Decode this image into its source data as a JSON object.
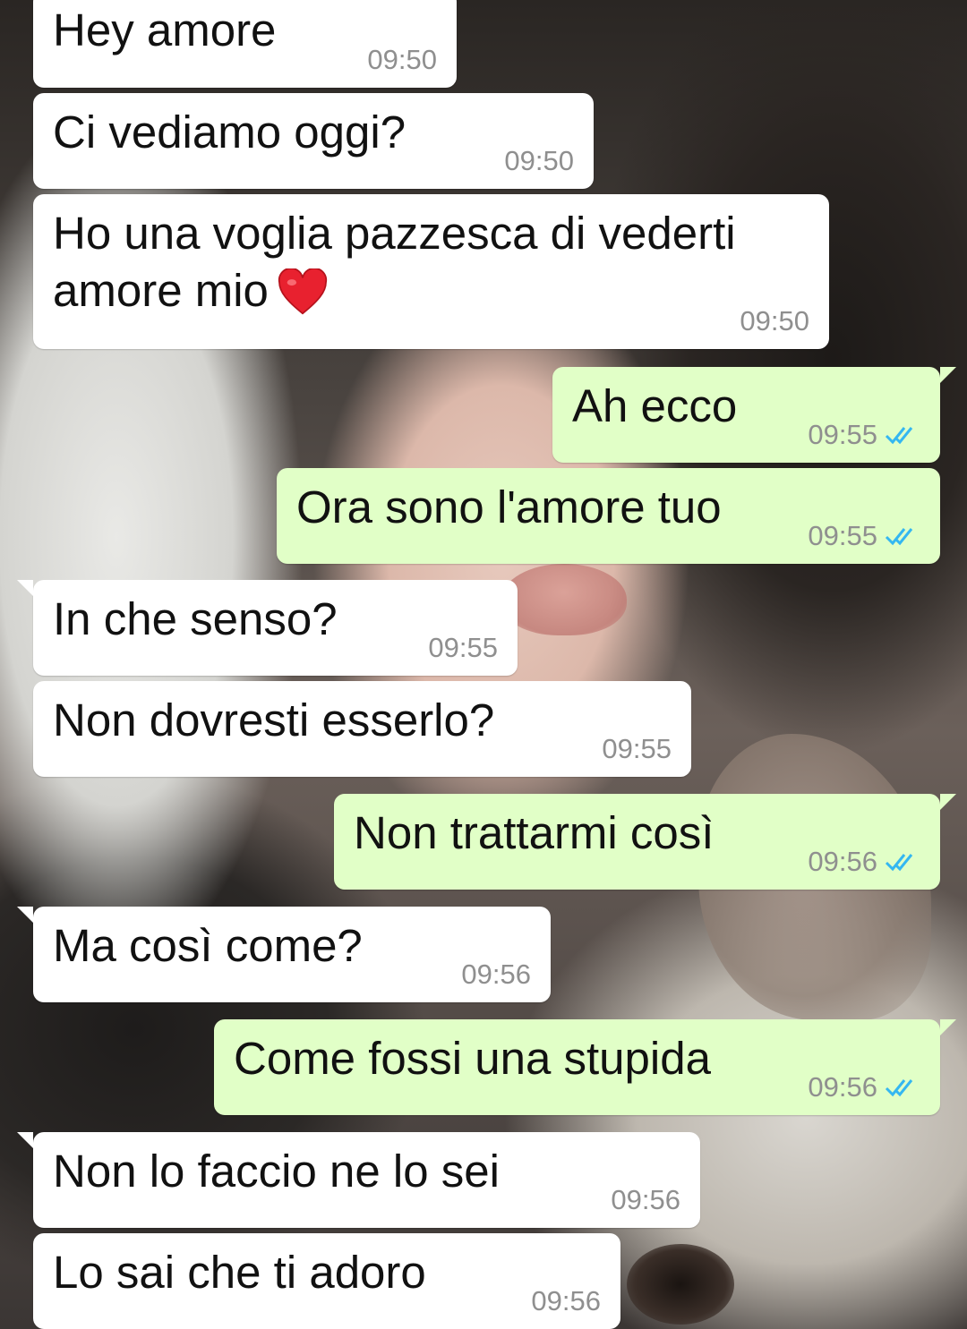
{
  "colors": {
    "incoming_bubble": "#ffffff",
    "outgoing_bubble": "#e1ffc7",
    "timestamp": "#8f8f8f",
    "read_ticks": "#34b7f1"
  },
  "messages": [
    {
      "dir": "in",
      "text": "Hey amore",
      "time": "09:50"
    },
    {
      "dir": "in",
      "text": "Ci vediamo oggi?",
      "time": "09:50"
    },
    {
      "dir": "in",
      "text": "Ho una voglia pazzesca di vederti",
      "text2": "amore mio",
      "emoji": "red-heart-icon",
      "time": "09:50"
    },
    {
      "dir": "out",
      "text": "Ah ecco",
      "time": "09:55",
      "status": "read"
    },
    {
      "dir": "out",
      "text": "Ora sono l'amore tuo",
      "time": "09:55",
      "status": "read"
    },
    {
      "dir": "in",
      "text": "In che senso?",
      "time": "09:55"
    },
    {
      "dir": "in",
      "text": "Non dovresti esserlo?",
      "time": "09:55"
    },
    {
      "dir": "out",
      "text": "Non trattarmi così",
      "time": "09:56",
      "status": "read"
    },
    {
      "dir": "in",
      "text": "Ma così come?",
      "time": "09:56"
    },
    {
      "dir": "out",
      "text": "Come fossi una stupida",
      "time": "09:56",
      "status": "read"
    },
    {
      "dir": "in",
      "text": "Non lo faccio ne lo sei",
      "time": "09:56"
    },
    {
      "dir": "in",
      "text": "Lo sai che ti adoro",
      "time": "09:56"
    }
  ]
}
